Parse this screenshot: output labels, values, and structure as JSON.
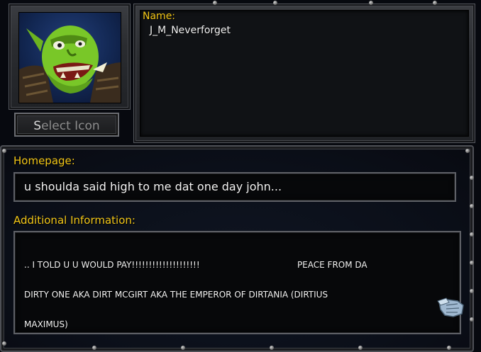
{
  "profile": {
    "name_label": "Name:",
    "name_value": "J_M_Neverforget",
    "select_icon_first": "S",
    "select_icon_rest": "elect Icon",
    "avatar_icon": "orc-grunt-portrait-icon"
  },
  "homepage": {
    "label": "Homepage:",
    "value": "u shoulda said high to me dat one day john..."
  },
  "additional": {
    "label": "Additional Information:",
    "value_line1": ".. I TOLD U U WOULD PAY!!!!!!!!!!!!!!!!!!!!                                    PEACE FROM DA",
    "value_line2": "DIRTY ONE AKA DIRT MCGIRT AKA THE EMPEROR OF DIRTANIA (DIRTIUS",
    "value_line3": "MAXIMUS)"
  },
  "colors": {
    "label_gold": "#f2c617",
    "text_white": "#f3f3f3",
    "background": "#07090f"
  }
}
